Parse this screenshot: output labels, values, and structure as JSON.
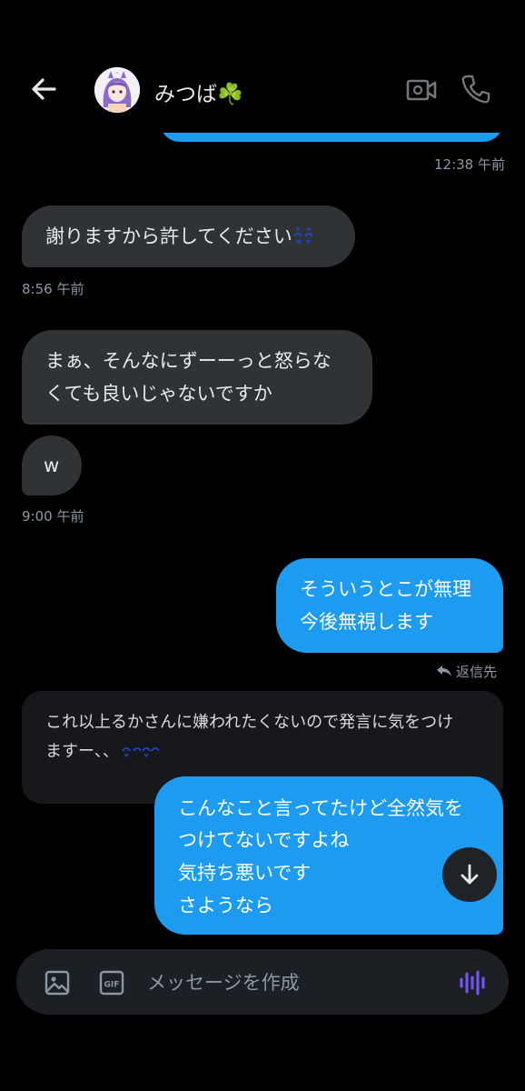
{
  "header": {
    "contact_name": "みつば☘️",
    "back_icon": "arrow-left-icon",
    "video_icon": "video-camera-icon",
    "call_icon": "phone-icon"
  },
  "messages": [
    {
      "type": "sent_timestamp",
      "time": "12:38 午前"
    },
    {
      "type": "received",
      "lines": [
        "謝りますから許してください"
      ],
      "emoji": "cold-sweat-emoji",
      "time": "8:56 午前"
    },
    {
      "type": "received",
      "lines": [
        "まぁ、そんなにずーーっと怒らな",
        "くても良いじゃないですか"
      ]
    },
    {
      "type": "received",
      "lines": [
        "w"
      ],
      "time": "9:00 午前"
    },
    {
      "type": "sent",
      "lines": [
        "そういうとこが無理",
        "今後無視します"
      ]
    }
  ],
  "reply": {
    "label": "返信先",
    "icon": "reply-arrow-icon",
    "quoted_lines": [
      "これ以上るかさんに嫌われたくないので発言に気をつけ",
      "ますー、、"
    ],
    "quoted_emoji": "cold-sweat-emoji"
  },
  "last_sent": {
    "lines": [
      "こんなこと言ってたけど全然気を",
      "つけてないですよね",
      "気持ち悪いです",
      "さようなら"
    ]
  },
  "composer": {
    "placeholder": "メッセージを作成",
    "image_icon": "image-icon",
    "gif_icon": "gif-icon",
    "gif_label": "GIF",
    "voice_icon": "voice-waveform-icon"
  },
  "scroll_button_icon": "arrow-down-icon",
  "colors": {
    "background": "#000000",
    "sent_bubble": "#1d9bf0",
    "received_bubble": "#2f3336",
    "quote_bubble": "#16181c",
    "timestamp": "#8b98a5",
    "voice_accent": "#7856ff"
  }
}
